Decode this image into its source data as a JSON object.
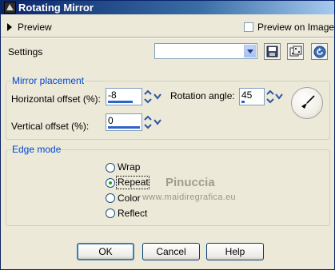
{
  "window": {
    "title": "Rotating Mirror"
  },
  "preview": {
    "label": "Preview",
    "checkbox_label": "Preview on Image",
    "checked": false
  },
  "settings": {
    "label": "Settings",
    "preset_value": ""
  },
  "mirror_placement": {
    "title": "Mirror placement",
    "horizontal_offset_label": "Horizontal offset (%):",
    "horizontal_offset_value": "-8",
    "vertical_offset_label": "Vertical offset (%):",
    "vertical_offset_value": "0",
    "rotation_angle_label": "Rotation angle:",
    "rotation_angle_value": "45"
  },
  "edge_mode": {
    "title": "Edge mode",
    "options": [
      "Wrap",
      "Repeat",
      "Color",
      "Reflect"
    ],
    "selected": "Repeat"
  },
  "watermark": {
    "line1": "Pinuccia",
    "line2": "www.maidiregrafica.eu"
  },
  "buttons": {
    "ok": "OK",
    "cancel": "Cancel",
    "help": "Help"
  },
  "colors": {
    "group_title": "#0046d5",
    "titlebar_start": "#0a246a",
    "radio_dot": "#21a121"
  }
}
